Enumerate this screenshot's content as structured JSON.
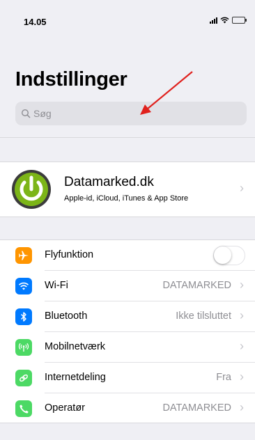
{
  "status": {
    "time": "14.05"
  },
  "header": {
    "title": "Indstillinger"
  },
  "search": {
    "placeholder": "Søg"
  },
  "account": {
    "name": "Datamarked.dk",
    "subtitle": "Apple-id, iCloud, iTunes & App Store",
    "avatar_color": "#7cb518"
  },
  "settings": [
    {
      "label": "Flyfunktion",
      "value": "",
      "icon": "airplane-icon",
      "color": "#ff9500",
      "control": "toggle",
      "toggle_on": false
    },
    {
      "label": "Wi-Fi",
      "value": "DATAMARKED",
      "icon": "wifi-icon",
      "color": "#007aff",
      "control": "chevron"
    },
    {
      "label": "Bluetooth",
      "value": "Ikke tilsluttet",
      "icon": "bluetooth-icon",
      "color": "#007aff",
      "control": "chevron"
    },
    {
      "label": "Mobilnetværk",
      "value": "",
      "icon": "antenna-icon",
      "color": "#4cd964",
      "control": "chevron"
    },
    {
      "label": "Internetdeling",
      "value": "Fra",
      "icon": "link-icon",
      "color": "#4cd964",
      "control": "chevron"
    },
    {
      "label": "Operatør",
      "value": "DATAMARKED",
      "icon": "phone-icon",
      "color": "#4cd964",
      "control": "chevron"
    }
  ],
  "annotation": {
    "arrow_color": "#e0211d"
  }
}
